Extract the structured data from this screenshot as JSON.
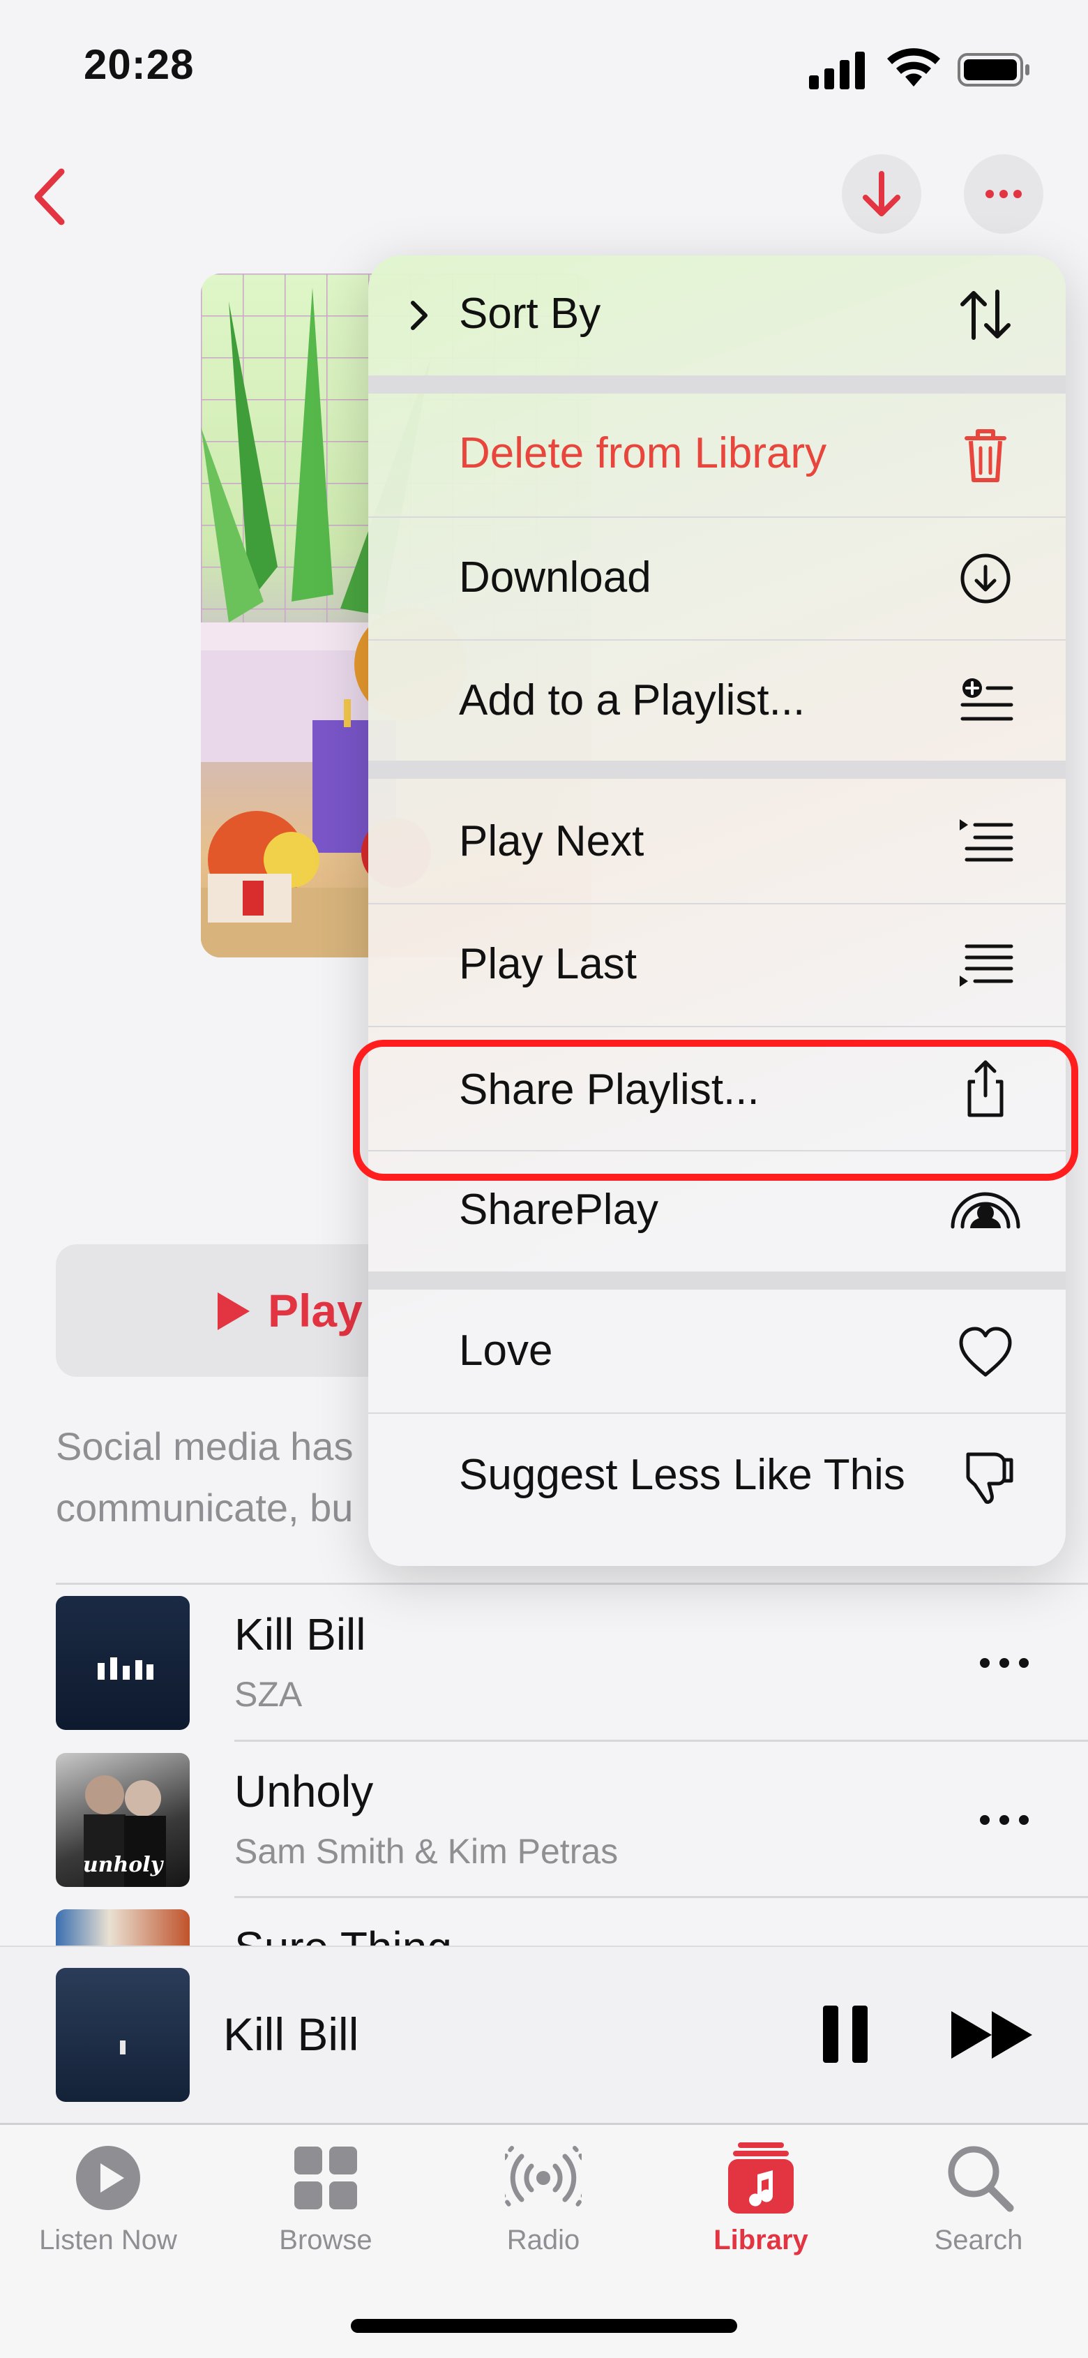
{
  "status_bar": {
    "time": "20:28"
  },
  "menu": {
    "items": [
      {
        "label": "Sort By",
        "icon": "sort-arrows-icon"
      },
      {
        "label": "Delete from Library",
        "icon": "trash-icon",
        "color": "#e8453c"
      },
      {
        "label": "Download",
        "icon": "download-circle-icon"
      },
      {
        "label": "Add to a Playlist...",
        "icon": "add-to-playlist-icon"
      },
      {
        "label": "Play Next",
        "icon": "play-next-icon"
      },
      {
        "label": "Play Last",
        "icon": "play-last-icon"
      },
      {
        "label": "Share Playlist...",
        "icon": "share-icon"
      },
      {
        "label": "SharePlay",
        "icon": "shareplay-icon"
      },
      {
        "label": "Love",
        "icon": "heart-icon"
      },
      {
        "label": "Suggest Less Like This",
        "icon": "thumbs-down-icon"
      }
    ]
  },
  "playlist": {
    "play_label": "Play",
    "description_line_1": "Social media has",
    "description_line_2": "communicate, bu"
  },
  "tracks": [
    {
      "title": "Kill Bill",
      "artist": "SZA"
    },
    {
      "title": "Unholy",
      "artist": "Sam Smith & Kim Petras",
      "art_text": "unholy"
    },
    {
      "title": "Sure Thing",
      "artist": ""
    }
  ],
  "now_playing": {
    "title": "Kill Bill"
  },
  "tab_bar": {
    "tabs": [
      {
        "label": "Listen Now",
        "icon": "play-circle-icon"
      },
      {
        "label": "Browse",
        "icon": "grid-icon"
      },
      {
        "label": "Radio",
        "icon": "radio-icon"
      },
      {
        "label": "Library",
        "icon": "library-icon",
        "active": true
      },
      {
        "label": "Search",
        "icon": "search-icon"
      }
    ]
  },
  "colors": {
    "accent": "#e33442",
    "destructive": "#e8453c",
    "highlight": "#ff1d1d"
  }
}
